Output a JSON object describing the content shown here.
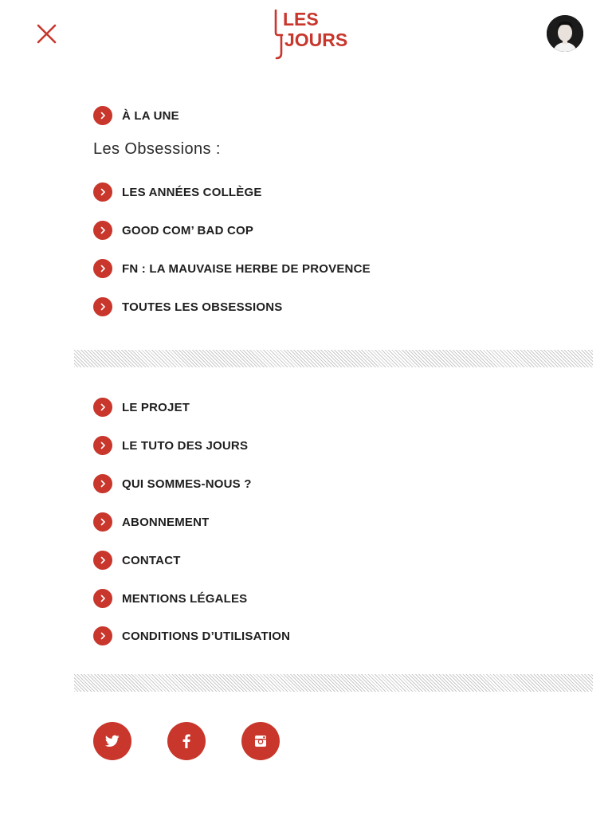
{
  "header": {
    "logo_line1": "LES",
    "logo_line2": "JOURS"
  },
  "menu_top": {
    "items": [
      {
        "label": "À LA UNE"
      }
    ]
  },
  "obsessions": {
    "heading": "Les Obsessions :",
    "items": [
      {
        "label": "LES ANNÉES COLLÈGE"
      },
      {
        "label": "GOOD COM’ BAD COP"
      },
      {
        "label": "FN : LA MAUVAISE HERBE DE PROVENCE"
      },
      {
        "label": "TOUTES LES OBSESSIONS"
      }
    ]
  },
  "info": {
    "items": [
      {
        "label": "LE PROJET"
      },
      {
        "label": "LE TUTO DES JOURS"
      },
      {
        "label": "QUI SOMMES-NOUS ?"
      },
      {
        "label": "ABONNEMENT"
      },
      {
        "label": "CONTACT"
      },
      {
        "label": "MENTIONS LÉGALES"
      },
      {
        "label": "CONDITIONS D’UTILISATION"
      }
    ]
  },
  "social": {
    "items": [
      {
        "icon": "twitter-icon"
      },
      {
        "icon": "facebook-icon"
      },
      {
        "icon": "instagram-icon"
      }
    ]
  },
  "colors": {
    "accent": "#c8362c",
    "text": "#1e1e1e",
    "background": "#ffffff"
  }
}
